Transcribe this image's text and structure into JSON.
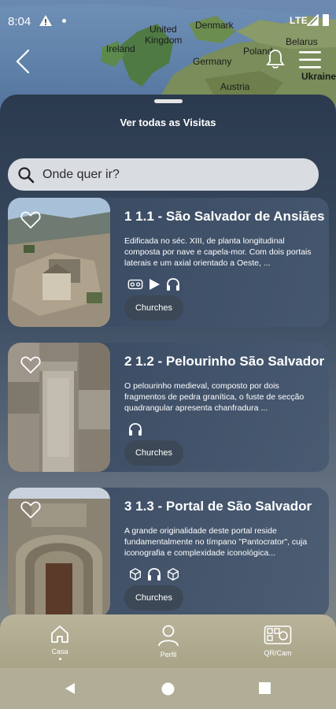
{
  "status_bar": {
    "time": "8:04",
    "network": "LTE"
  },
  "map": {
    "labels": [
      "United",
      "Kingdom",
      "Denmark",
      "Ireland",
      "Belarus",
      "Germany",
      "Poland",
      "Ukraine",
      "Austria"
    ]
  },
  "header": {
    "back_icon": "chevron-left-icon",
    "bell_icon": "bell-icon",
    "menu_icon": "hamburger-menu-icon"
  },
  "sheet": {
    "title": "Ver todas as Visitas"
  },
  "search": {
    "placeholder": "Onde quer ir?",
    "value": ""
  },
  "visits": [
    {
      "title": "1 1.1 - São Salvador de Ansiães",
      "description": "Edificada no séc. XIII, de planta longitudinal composta por nave e capela-mor. Com dois portais laterais e um axial orientado a Oeste, ...",
      "media_icons": [
        "vr-headset-icon",
        "play-icon",
        "headphones-icon"
      ],
      "tag": "Churches"
    },
    {
      "title": "2 1.2 - Pelourinho São Salvador",
      "description": "O pelourinho medieval, composto por dois fragmentos de pedra granítica, o fuste de secção quadrangular apresenta chanfradura ...",
      "media_icons": [
        "headphones-icon"
      ],
      "tag": "Churches"
    },
    {
      "title": "3 1.3 - Portal de São Salvador",
      "description": "A grande originalidade deste portal reside fundamentalmente no tímpano \"Pantocrator\", cuja iconografia e complexidade iconológica...",
      "media_icons": [
        "3d-cube-icon",
        "headphones-icon",
        "3d-cube-icon"
      ],
      "tag": "Churches"
    }
  ],
  "bottom_nav": {
    "items": [
      {
        "label": "Casa",
        "icon": "home-icon",
        "active": true
      },
      {
        "label": "Perfil",
        "icon": "person-icon",
        "active": false
      },
      {
        "label": "QR/Cam",
        "icon": "qr-camera-icon",
        "active": false
      }
    ]
  },
  "colors": {
    "sheet_top": "#2b3a4e",
    "card_bg": "#3b4c64",
    "nav_bg": "#b8b39a",
    "search_bg": "#d9dde2"
  }
}
